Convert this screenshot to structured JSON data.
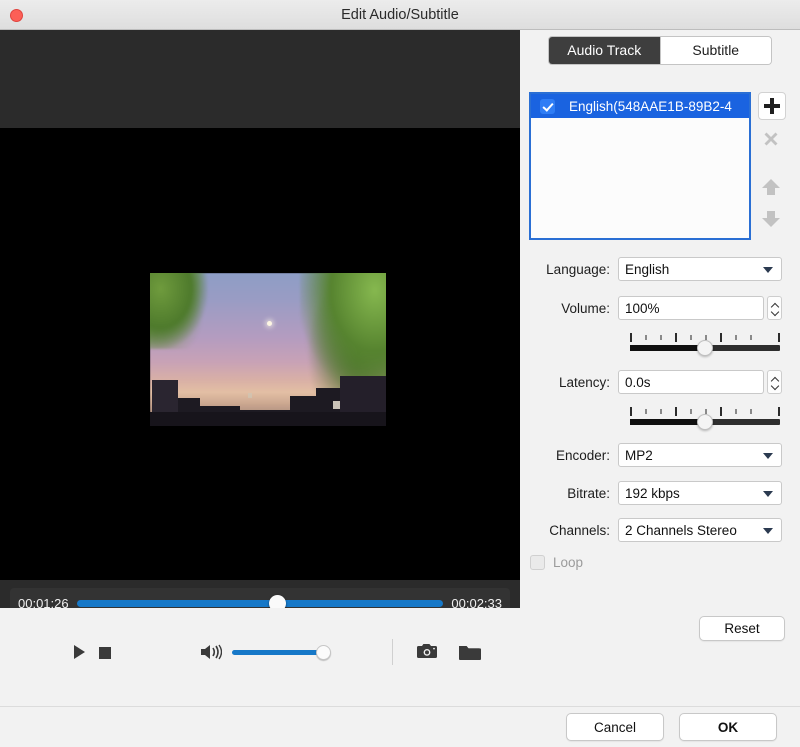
{
  "window": {
    "title": "Edit Audio/Subtitle",
    "close_button": "close"
  },
  "player": {
    "current_time": "00:01:26",
    "total_time": "00:02:33",
    "seek_percent": 54,
    "volume_percent": 100,
    "controls": {
      "play": "play-icon",
      "stop": "stop-icon",
      "speaker": "speaker-icon",
      "snapshot": "camera-icon",
      "folder": "folder-icon"
    }
  },
  "panel": {
    "tabs": [
      {
        "label": "Audio Track",
        "active": true
      },
      {
        "label": "Subtitle",
        "active": false
      }
    ],
    "track_list": [
      {
        "label": "English(548AAE1B-89B2-4",
        "checked": true,
        "selected": true
      }
    ],
    "list_buttons": [
      {
        "name": "add-track-button",
        "icon": "plus-icon",
        "enabled": true
      },
      {
        "name": "remove-track-button",
        "icon": "close-x-icon",
        "enabled": false
      },
      {
        "name": "move-up-button",
        "icon": "arrow-up-icon",
        "enabled": false
      },
      {
        "name": "move-down-button",
        "icon": "arrow-down-icon",
        "enabled": false
      }
    ],
    "fields": {
      "language": {
        "label": "Language:",
        "value": "English"
      },
      "volume": {
        "label": "Volume:",
        "value": "100%",
        "slider_percent": 50
      },
      "latency": {
        "label": "Latency:",
        "value": "0.0s",
        "slider_percent": 50
      },
      "encoder": {
        "label": "Encoder:",
        "value": "MP2"
      },
      "bitrate": {
        "label": "Bitrate:",
        "value": "192 kbps"
      },
      "channels": {
        "label": "Channels:",
        "value": "2 Channels Stereo"
      }
    },
    "loop": {
      "label": "Loop",
      "checked": false,
      "enabled": false
    },
    "reset_label": "Reset"
  },
  "footer": {
    "cancel_label": "Cancel",
    "ok_label": "OK"
  },
  "colors": {
    "accent_blue": "#1678c8",
    "selection_blue": "#1a63e0",
    "tab_active_bg": "#3e3e3e",
    "panel_bg": "#f2f2f2",
    "player_bg": "#2b2b2b"
  }
}
